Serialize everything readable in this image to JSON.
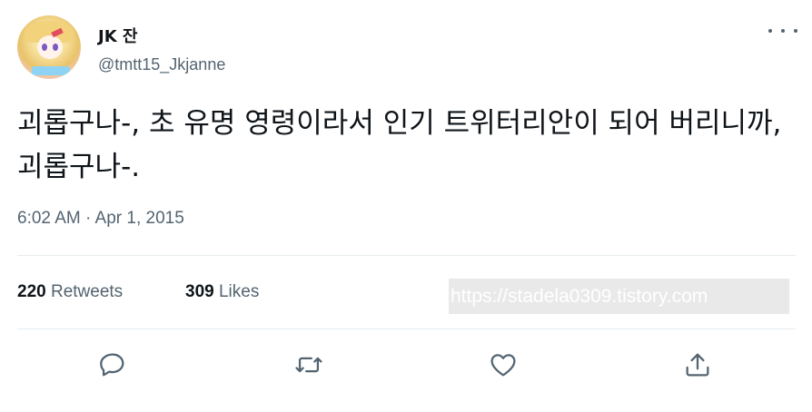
{
  "user": {
    "display_name": "JK 잔",
    "handle": "@tmtt15_Jkjanne"
  },
  "tweet": {
    "text": "괴롭구나-, 초 유명 영령이라서 인기 트위터리안이 되어 버리니까, 괴롭구나-.",
    "timestamp": "6:02 AM · Apr 1, 2015"
  },
  "stats": {
    "retweets_count": "220",
    "retweets_label": "Retweets",
    "likes_count": "309",
    "likes_label": "Likes"
  },
  "watermark": "https://stadela0309.tistory.com",
  "icons": {
    "more": "more-horizontal-icon",
    "reply": "reply-icon",
    "retweet": "retweet-icon",
    "like": "heart-icon",
    "share": "share-icon"
  },
  "colors": {
    "text": "#0f1419",
    "secondary": "#536471",
    "divider": "#e6ecf0"
  }
}
